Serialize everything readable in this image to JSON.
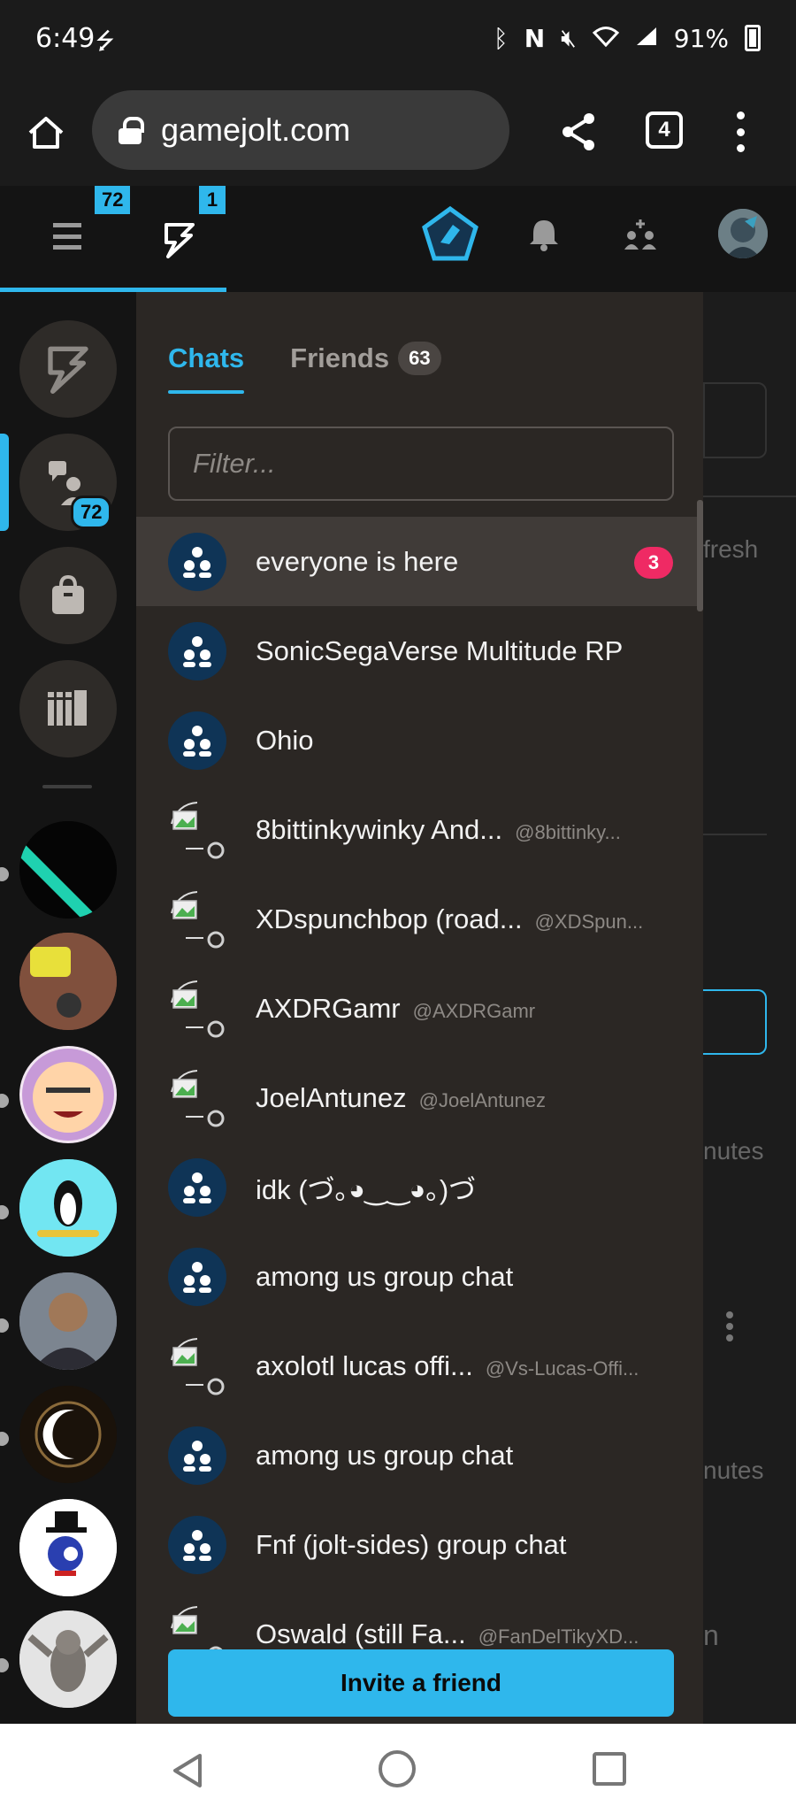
{
  "status_bar": {
    "time": "6:49",
    "battery": "91%",
    "icons": [
      "usb-icon",
      "bluetooth-icon",
      "nfc-icon",
      "mute-icon",
      "wifi-icon",
      "signal-icon",
      "battery-icon"
    ]
  },
  "browser": {
    "url": "gamejolt.com",
    "tab_count": "4"
  },
  "app_header": {
    "menu_badge": "72",
    "activity_badge": "1"
  },
  "rail": {
    "chat_count": "72"
  },
  "chat_panel": {
    "tabs": [
      {
        "label": "Chats"
      },
      {
        "label": "Friends",
        "count": "63"
      }
    ],
    "filter_placeholder": "Filter...",
    "rooms": [
      {
        "name": "everyone is here",
        "handle": "",
        "type": "group",
        "unread": "3"
      },
      {
        "name": "SonicSegaVerse Multitude RP",
        "handle": "",
        "type": "group"
      },
      {
        "name": "Ohio",
        "handle": "",
        "type": "group"
      },
      {
        "name": "8bittinkywinky And...",
        "handle": "@8bittinky...",
        "type": "user"
      },
      {
        "name": "XDspunchbop (road...",
        "handle": "@XDSpun...",
        "type": "user"
      },
      {
        "name": "AXDRGamr",
        "handle": "@AXDRGamr",
        "type": "user"
      },
      {
        "name": "JoelAntunez",
        "handle": "@JoelAntunez",
        "type": "user"
      },
      {
        "name": "idk (づ｡◕‿‿◕｡)づ",
        "handle": "",
        "type": "group"
      },
      {
        "name": "among us group chat",
        "handle": "",
        "type": "group"
      },
      {
        "name": "axolotl lucas offi...",
        "handle": "@Vs-Lucas-Offi...",
        "type": "user"
      },
      {
        "name": "among us group chat",
        "handle": "",
        "type": "group"
      },
      {
        "name": "Fnf (jolt-sides) group chat",
        "handle": "",
        "type": "group"
      },
      {
        "name": "Oswald (still Fa...",
        "handle": "@FanDelTikyXD...",
        "type": "user"
      }
    ],
    "invite_label": "Invite a friend"
  },
  "background_page": {
    "fragments": [
      "fresh",
      "nutes",
      "nutes",
      "n"
    ]
  },
  "colors": {
    "accent": "#2fb7ec",
    "panel": "#2b2724",
    "unread": "#ef2a64",
    "group_avatar": "#0f3456"
  }
}
